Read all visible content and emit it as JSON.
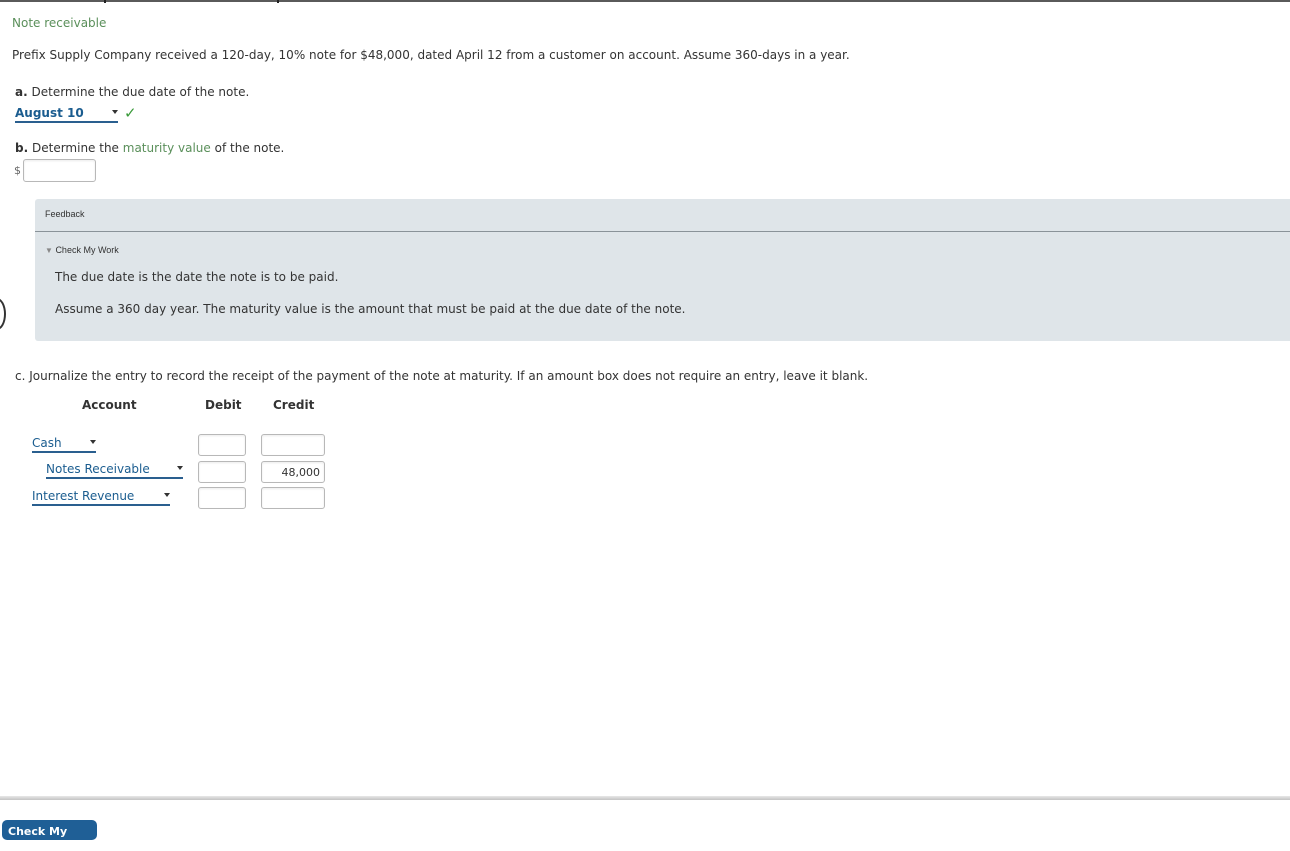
{
  "title": "Note receivable",
  "prompt": "Prefix Supply Company received a 120-day, 10% note for $48,000, dated April 12 from a customer on account. Assume 360-days in a year.",
  "part_a": {
    "letter": "a.",
    "text": "Determine the due date of the note.",
    "selected": "August 10",
    "status_icon": "check-icon",
    "check_glyph": "✓"
  },
  "part_b": {
    "letter": "b.",
    "text_before": "Determine the",
    "link": "maturity value",
    "text_after": "of the note.",
    "currency": "$",
    "value": ""
  },
  "feedback": {
    "title": "Feedback",
    "toggle_glyph": "▼",
    "toggle": "Check My Work",
    "lines": [
      "The due date is the date the note is to be paid.",
      "Assume a 360 day year. The maturity value is the amount that must be paid at the due date of the note."
    ]
  },
  "part_c": {
    "letter": "c.",
    "text": "Journalize the entry to record the receipt of the payment of the note at maturity. If an amount box does not require an entry, leave it blank.",
    "headers": {
      "account": "Account",
      "debit": "Debit",
      "credit": "Credit"
    },
    "rows": [
      {
        "account": "Cash",
        "debit": "",
        "credit": ""
      },
      {
        "account": "Notes Receivable",
        "debit": "",
        "credit": "48,000"
      },
      {
        "account": "Interest Revenue",
        "debit": "",
        "credit": ""
      }
    ]
  },
  "footer": {
    "button": "Check My Work"
  },
  "colors": {
    "accent_green": "#5a8f5a",
    "link_blue": "#1a5c8f",
    "button_blue": "#1f5f96",
    "feedback_bg": "#dfe5e9"
  }
}
